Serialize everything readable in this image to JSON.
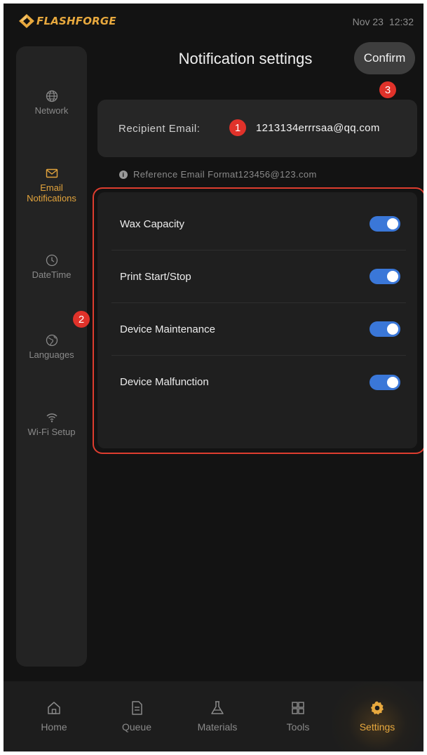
{
  "status_bar": {
    "brand": "FLASHFORGE",
    "date": "Nov 23",
    "time": "12:32"
  },
  "sidebar": {
    "items": [
      {
        "label": "Network",
        "icon": "globe-icon",
        "active": false
      },
      {
        "label": "Email Notifications",
        "icon": "mail-icon",
        "active": true
      },
      {
        "label": "DateTime",
        "icon": "clock-icon",
        "active": false
      },
      {
        "label": "Languages",
        "icon": "languages-icon",
        "active": false
      },
      {
        "label": "Wi-Fi Setup",
        "icon": "wifi-icon",
        "active": false
      }
    ]
  },
  "header": {
    "title": "Notification settings",
    "confirm_label": "Confirm"
  },
  "email": {
    "label": "Recipient Email:",
    "value": "1213134errrsaa@qq.com",
    "hint": "Reference Email Format123456@123.com"
  },
  "notifications": [
    {
      "label": "Wax Capacity",
      "enabled": true
    },
    {
      "label": "Print Start/Stop",
      "enabled": true
    },
    {
      "label": "Device Maintenance",
      "enabled": true
    },
    {
      "label": "Device Malfunction",
      "enabled": true
    }
  ],
  "annotations": [
    "1",
    "2",
    "3"
  ],
  "bottom_nav": [
    {
      "label": "Home",
      "icon": "home-icon",
      "active": false
    },
    {
      "label": "Queue",
      "icon": "queue-file-icon",
      "active": false
    },
    {
      "label": "Materials",
      "icon": "flask-icon",
      "active": false
    },
    {
      "label": "Tools",
      "icon": "grid-icon",
      "active": false
    },
    {
      "label": "Settings",
      "icon": "gear-icon",
      "active": true
    }
  ],
  "colors": {
    "accent": "#e8a93e",
    "toggle_on": "#3a77d8",
    "annotation": "#e0322a",
    "background": "#131313"
  }
}
